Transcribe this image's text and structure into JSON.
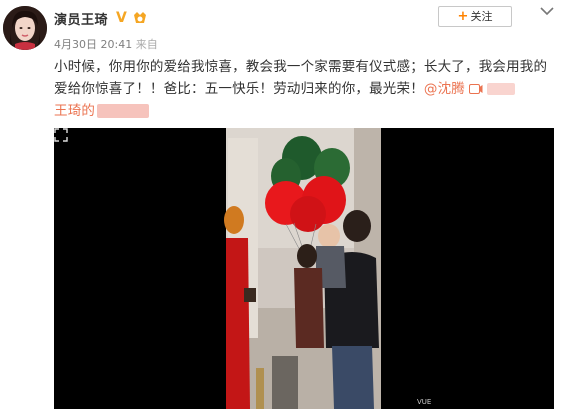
{
  "post": {
    "username": "演员王琦",
    "verified_badge": "V",
    "date": "4月30日",
    "time": "20:41",
    "source_prefix": "来自",
    "text_main": "小时候，你用你的爱给我惊喜，教会我一个家需要有仪式感；长大了，我会用我的爱给你惊喜了！！爸比：五一快乐！劳动归来的你，最光荣！",
    "mention": "@沈腾",
    "text_tail": "王琦的"
  },
  "actions": {
    "follow_label": "关注",
    "follow_plus": "+"
  },
  "icons": {
    "avatar": "avatar-photo",
    "verified": "verified-v-icon",
    "link": "video-link-icon",
    "chevron": "chevron-down-icon",
    "expand": "expand-icon"
  },
  "colors": {
    "mention": "#eb7350",
    "follow_plus": "#ff8200",
    "verified": "#f5a623"
  },
  "video": {
    "watermark": "VUE"
  }
}
